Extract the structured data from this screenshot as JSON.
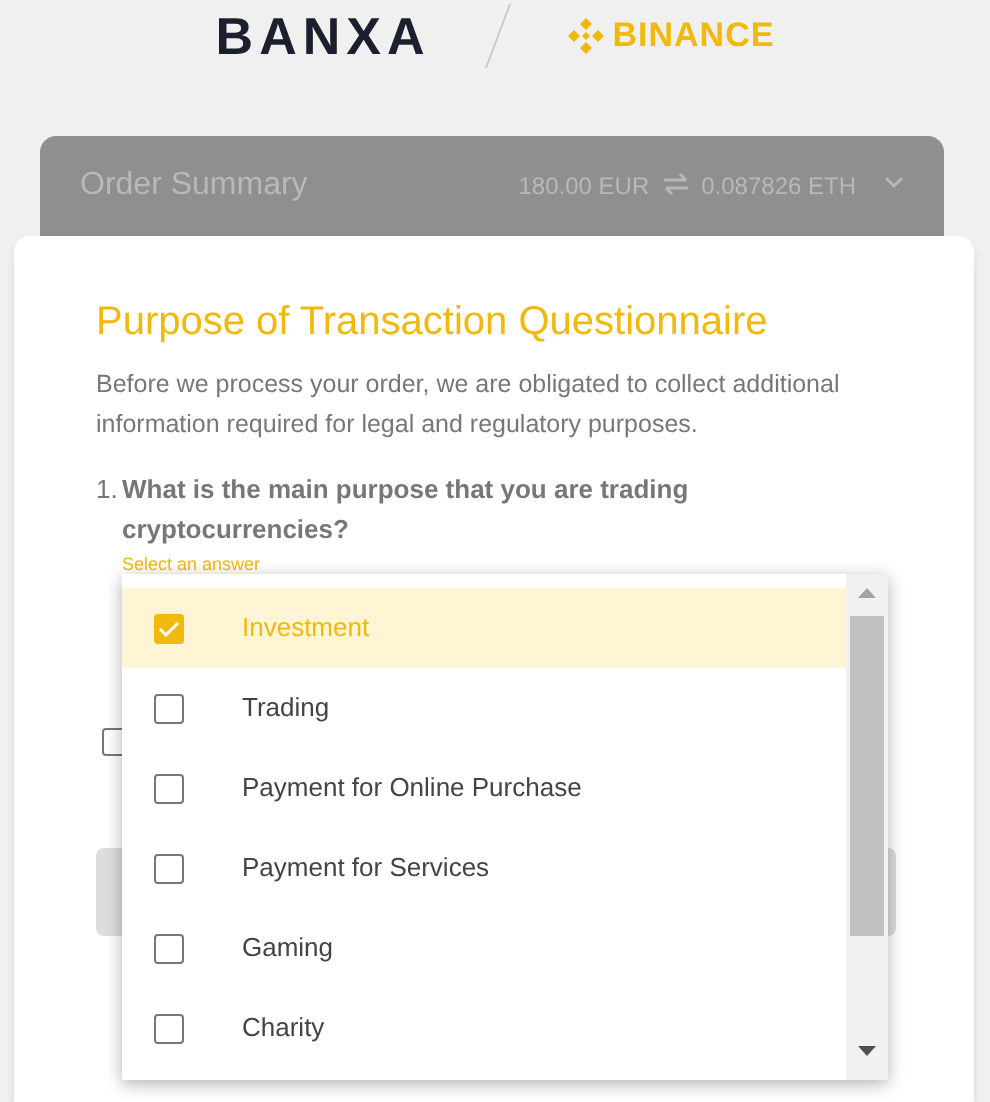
{
  "header": {
    "logo": "BANXA",
    "partner": "BINANCE"
  },
  "order_summary": {
    "title": "Order Summary",
    "amount": "180.00 EUR",
    "crypto": "0.087826 ETH",
    "expanded": false
  },
  "card": {
    "title": "Purpose of Transaction Questionnaire",
    "intro": "Before we process your order, we are obligated to collect additional information required for legal and regulatory purposes.",
    "question": {
      "number": "1.",
      "text": "What is the main purpose that you are trading cryptocurrencies?",
      "hint": "Select an answer"
    },
    "checkbox": {
      "checked": false
    }
  },
  "dropdown": {
    "options": [
      {
        "label": "Investment",
        "selected": true
      },
      {
        "label": "Trading",
        "selected": false
      },
      {
        "label": "Payment for Online Purchase",
        "selected": false
      },
      {
        "label": "Payment for Services",
        "selected": false
      },
      {
        "label": "Gaming",
        "selected": false
      },
      {
        "label": "Charity",
        "selected": false
      }
    ]
  }
}
